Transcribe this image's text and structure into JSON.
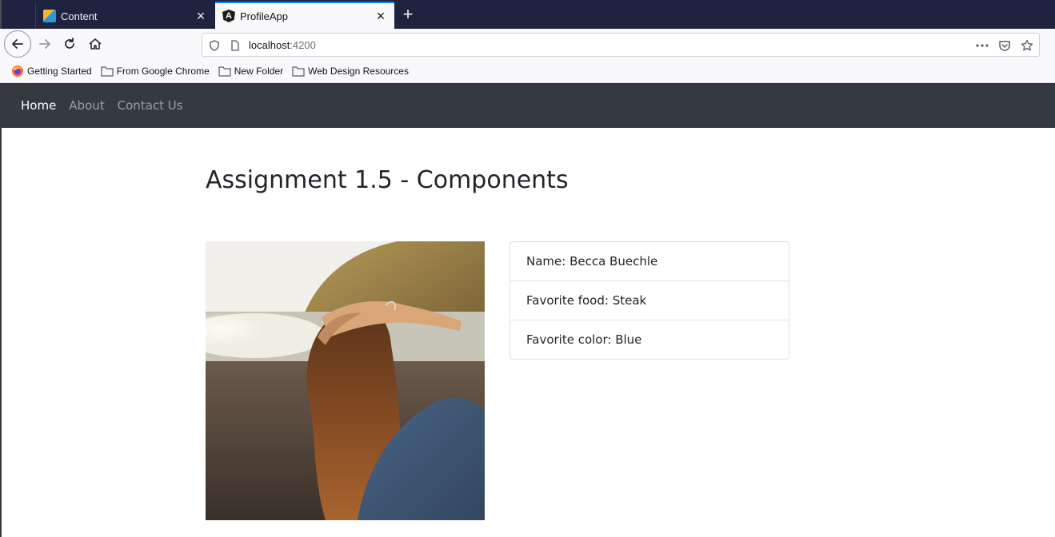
{
  "browser": {
    "tabs": [
      {
        "title": "Content",
        "icon": "content-favicon-icon",
        "active": false
      },
      {
        "title": "ProfileApp",
        "icon": "angular-favicon-icon",
        "active": true
      }
    ],
    "url": {
      "host": "localhost",
      "port": ":4200"
    },
    "bookmarks": [
      {
        "label": "Getting Started",
        "icon": "firefox-icon"
      },
      {
        "label": "From Google Chrome",
        "icon": "folder-icon"
      },
      {
        "label": "New Folder",
        "icon": "folder-icon"
      },
      {
        "label": "Web Design Resources",
        "icon": "folder-icon"
      }
    ]
  },
  "app": {
    "nav": {
      "items": [
        {
          "label": "Home",
          "active": true
        },
        {
          "label": "About",
          "active": false
        },
        {
          "label": "Contact Us",
          "active": false
        }
      ]
    },
    "heading": "Assignment 1.5 - Components",
    "profile": {
      "items": [
        "Name: Becca Buechle",
        "Favorite food: Steak",
        "Favorite color: Blue"
      ]
    }
  },
  "colors": {
    "tabbar": "#202340",
    "app_nav": "#343a40",
    "accent": "#0a84ff"
  }
}
